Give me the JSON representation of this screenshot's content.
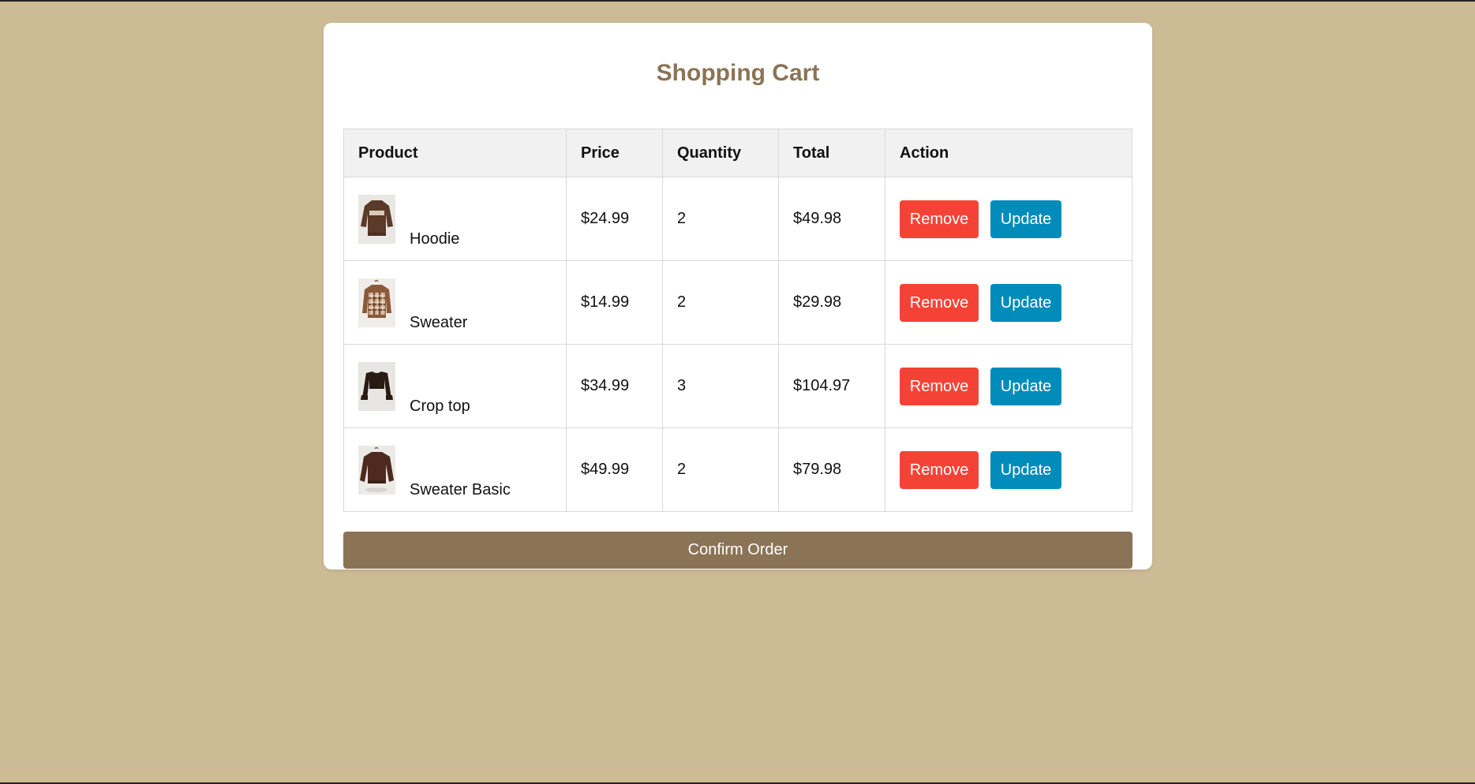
{
  "page": {
    "title": "Shopping Cart",
    "colors": {
      "background": "#cdbb96",
      "card": "#ffffff",
      "accent": "#8b7355",
      "remove": "#f44336",
      "update": "#008cba",
      "header_bg": "#f1f1f1"
    }
  },
  "table": {
    "headers": {
      "product": "Product",
      "price": "Price",
      "quantity": "Quantity",
      "total": "Total",
      "action": "Action"
    },
    "rows": [
      {
        "name": "Hoodie",
        "price": "$24.99",
        "quantity": "2",
        "total": "$49.98",
        "remove_label": "Remove",
        "update_label": "Update",
        "thumb_icon": "hoodie-thumbnail"
      },
      {
        "name": "Sweater",
        "price": "$14.99",
        "quantity": "2",
        "total": "$29.98",
        "remove_label": "Remove",
        "update_label": "Update",
        "thumb_icon": "plaid-sweater-thumbnail"
      },
      {
        "name": "Crop top",
        "price": "$34.99",
        "quantity": "3",
        "total": "$104.97",
        "remove_label": "Remove",
        "update_label": "Update",
        "thumb_icon": "crop-top-thumbnail"
      },
      {
        "name": "Sweater Basic",
        "price": "$49.99",
        "quantity": "2",
        "total": "$79.98",
        "remove_label": "Remove",
        "update_label": "Update",
        "thumb_icon": "basic-sweater-thumbnail"
      }
    ]
  },
  "confirm": {
    "label": "Confirm Order"
  }
}
